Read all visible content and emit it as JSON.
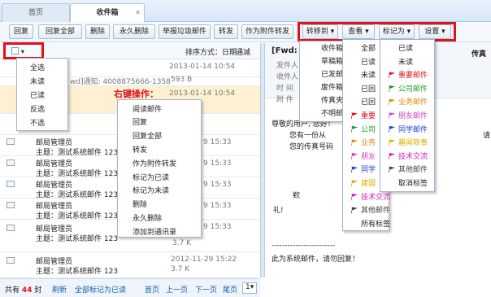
{
  "tabs": {
    "home": "首页",
    "inbox": "收件箱",
    "close": "✕"
  },
  "toolbar": {
    "reply": "回复",
    "reply_all": "回复全部",
    "delete": "删除",
    "perm_delete": "永久删除",
    "report_spam": "举报垃圾邮件",
    "forward": "转发",
    "forward_attach": "作为附件转发",
    "move_to": "转移到",
    "view": "查看",
    "mark_as": "标记为",
    "settings": "设置"
  },
  "list": {
    "sort_label": "排序方式：日期",
    "filter": "通减",
    "select_all_menu": [
      "全选",
      "未读",
      "已读",
      "反选",
      "不选"
    ],
    "rows": [
      {
        "text": "",
        "date": "2013-01-14 10:54",
        "size": "593 B"
      },
      {
        "text": "wd]通知: 4008875666-1358",
        "date": "2013-01-14 10:54",
        "size": "593 B"
      },
      {
        "text": "",
        "date": "2013-01-14 10:54",
        "size": ""
      },
      {
        "text": "",
        "date": "",
        "size": ""
      },
      {
        "sender": "邮局管理员",
        "subject": "主题：测试系统邮件 123",
        "date": "9 15:33"
      },
      {
        "sender": "邮局管理员",
        "subject": "主题：测试系统邮件 123",
        "date": "9 15:33"
      },
      {
        "sender": "邮局管理员",
        "subject": "主题：测试系统邮件 123",
        "date": "9 15:33"
      },
      {
        "sender": "邮局管理员",
        "subject": "主题：测试系统邮件 123",
        "date": "9 15:33"
      },
      {
        "sender": "邮局管理员",
        "subject": "主题：测试系统邮件 123",
        "date": "9 15:33",
        "size": "3.7 K"
      },
      {
        "sender": "邮局管理员",
        "subject": "主题：测试系统邮件 123",
        "date": "2012-11-29 15:22",
        "size": "3.7 K"
      }
    ]
  },
  "context_label": "右键操作：",
  "context_menu": [
    "阅读邮件",
    "回复",
    "回复全部",
    "转发",
    "作为附件转发",
    "标记为已读",
    "标记为未读",
    "删除",
    "永久删除",
    "添加到通讯录"
  ],
  "move_menu": [
    "收件箱",
    "草稿箱",
    "已发邮件",
    "废件箱",
    "传真夹",
    "不明邮件"
  ],
  "view_menu": [
    "全部",
    "已读",
    "未读",
    "已回",
    "已回",
    "重要",
    "公司",
    "业务",
    "朋友",
    "同学",
    "建国",
    "技术交流",
    "其他邮件",
    "所有标签"
  ],
  "view_colors": [
    "",
    "",
    "",
    "",
    "",
    "#e0121c",
    "#1c9a2a",
    "#e08a10",
    "#d040d0",
    "#2040d0",
    "#d8b000",
    "#d020c0",
    "#444444",
    ""
  ],
  "mark_menu": [
    "已读",
    "未读",
    "重要邮件",
    "公司邮件",
    "业务邮件",
    "朋友邮件",
    "同学邮件",
    "趣闻轶事",
    "技术交流",
    "其他邮件",
    "取消标签"
  ],
  "mark_colors": [
    "",
    "",
    "#e0121c",
    "#1c9a2a",
    "#e08a10",
    "#d040d0",
    "#2040d0",
    "#d8b000",
    "#d020c0",
    "#444444",
    ""
  ],
  "preview": {
    "title": "[Fwd:",
    "title_right": "传真",
    "labels": [
      "发件人",
      "收件人",
      "时 间",
      "附 件"
    ],
    "body": [
      "尊敬的用户, 您好！",
      "您有一份从",
      "您的传真号码",
      "欸",
      "礼!",
      "------------------------",
      "此为系统邮件，请勿回复！"
    ],
    "body_right": "请"
  },
  "footer": {
    "total_pre": "共有",
    "count": "44",
    "total_post": "封",
    "refresh": "刷新",
    "mark_all": "全部标记为已读",
    "home": "首页",
    "prev": "上一页",
    "next": "下一页",
    "last": "尾页",
    "page": "1"
  }
}
